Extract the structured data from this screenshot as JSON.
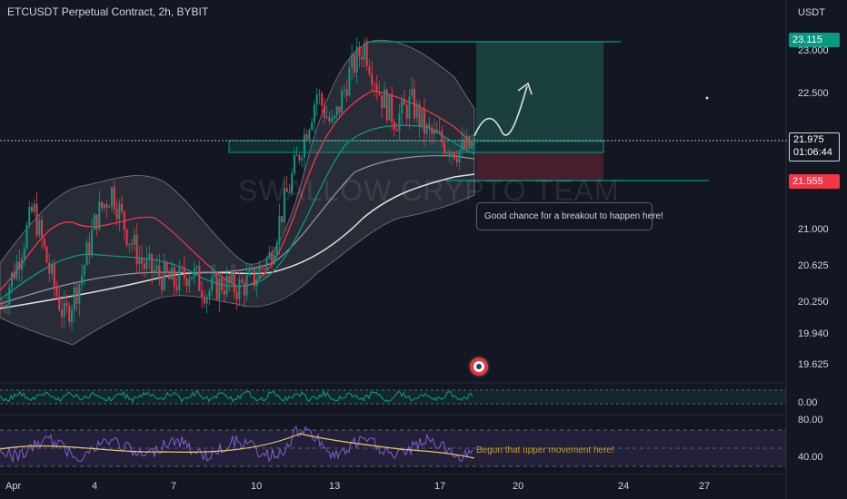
{
  "header": {
    "title": "ETCUSDT Perpetual Contract, 2h, BYBIT",
    "currency": "USDT"
  },
  "watermark": "SWALLOW CRYPTO TEAM",
  "annotations": {
    "breakout_note": "Good chance for a breakout to happen here!",
    "rsi_note": "Begun that upper movement here!"
  },
  "price_tags": {
    "target": "23.115",
    "last": "21.975",
    "countdown": "01:06:44",
    "stop": "21.555"
  },
  "price_scale": [
    "23.000",
    "22.500",
    "21.000",
    "20.625",
    "20.250",
    "19.940",
    "19.625"
  ],
  "indicator_scales": {
    "oscillator": "0.00",
    "rsi_high": "80.00",
    "rsi_low": "40.00"
  },
  "date_axis": [
    "Apr",
    "4",
    "7",
    "10",
    "13",
    "17",
    "20",
    "24",
    "27"
  ],
  "colors": {
    "background": "#131722",
    "up": "#089981",
    "down": "#f23645",
    "target_zone": "#1f4e45",
    "stop_zone": "#5a2230",
    "rsi_line": "#7e57c2",
    "rsi_ma": "#e6c86e"
  },
  "chart_data": {
    "type": "candlestick",
    "symbol": "ETCUSDT Perpetual Contract",
    "interval": "2h",
    "exchange": "BYBIT",
    "ylim": [
      19.45,
      23.25
    ],
    "key_levels": {
      "target": 23.115,
      "last_price": 21.975,
      "stop": 21.555
    },
    "close_path": [
      20.1,
      20.6,
      21.2,
      20.5,
      19.95,
      20.4,
      21.1,
      21.4,
      20.9,
      20.55,
      20.45,
      20.35,
      20.5,
      20.25,
      20.35,
      20.3,
      20.4,
      20.65,
      21.3,
      21.9,
      22.5,
      22.1,
      22.7,
      23.05,
      22.5,
      22.2,
      22.4,
      22.05,
      21.95,
      21.85,
      21.9
    ]
  }
}
